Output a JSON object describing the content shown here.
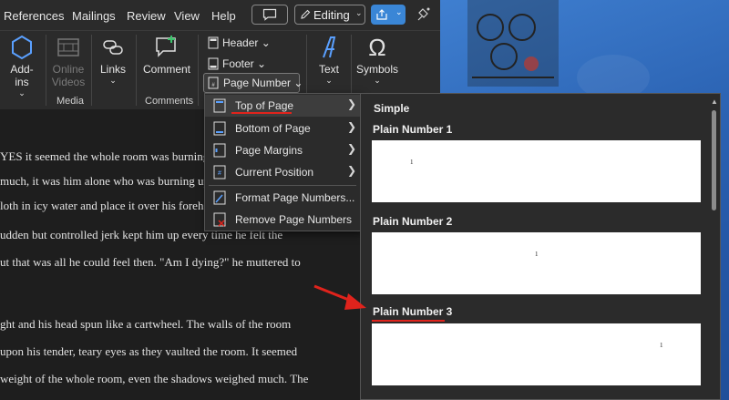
{
  "menubar": {
    "tabs": [
      "References",
      "Mailings",
      "Review",
      "View",
      "Help"
    ],
    "editing_label": "Editing"
  },
  "ribbon": {
    "addins_label": "Add-ins",
    "online_videos_label": "Online Videos",
    "media_group": "Media",
    "links_label": "Links",
    "comment_label": "Comment",
    "comments_group": "Comments",
    "header_label": "Header",
    "footer_label": "Footer",
    "page_number_label": "Page Number",
    "text_label": "Text",
    "symbols_label": "Symbols"
  },
  "page_number_menu": {
    "items": [
      {
        "label": "Top of Page",
        "has_submenu": true
      },
      {
        "label": "Bottom of Page",
        "has_submenu": true
      },
      {
        "label": "Page Margins",
        "has_submenu": true
      },
      {
        "label": "Current Position",
        "has_submenu": true
      },
      {
        "label": "Format Page Numbers...",
        "has_submenu": false
      },
      {
        "label": "Remove Page Numbers",
        "has_submenu": false
      }
    ]
  },
  "gallery": {
    "section": "Simple",
    "options": [
      {
        "label": "Plain Number 1",
        "preview": "1",
        "align": "left"
      },
      {
        "label": "Plain Number 2",
        "preview": "1",
        "align": "center"
      },
      {
        "label": "Plain Number 3",
        "preview": "1",
        "align": "right"
      }
    ]
  },
  "document": {
    "lines": [
      "YES it seemed the whole room was burning",
      "much, it was him alone who was burning up",
      "loth in icy water and place it over his foreh",
      "udden but controlled jerk kept him up every time he felt the",
      "ut that was all he could feel then. \"Am I dying?\" he muttered to",
      "",
      "ght and his head spun like a cartwheel. The walls of the room",
      " upon his tender, teary eyes as they vaulted the room. It seemed",
      "weight of the whole room, even the shadows weighed much. The"
    ]
  },
  "annotation": {
    "color": "#e0231c"
  }
}
